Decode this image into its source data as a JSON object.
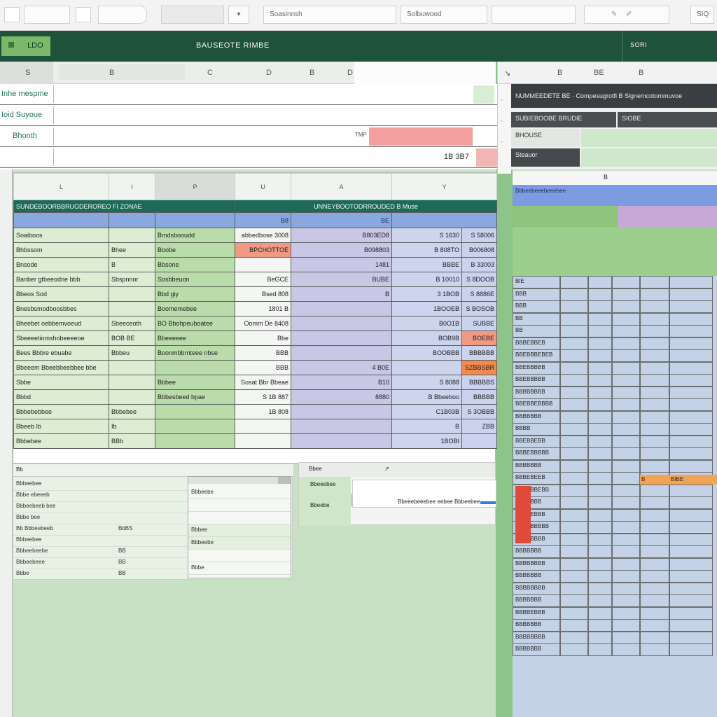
{
  "toolbar": {
    "field_1": "",
    "field_2": "",
    "field_3": "",
    "field_4": "Soasinnsh",
    "field_5": "Solbuwood",
    "field_6": "",
    "help_label": "SIQ"
  },
  "ribbon": {
    "active_tab": "LDO",
    "title": "BAUSEOTE RIMBE",
    "right_label": "SORI"
  },
  "column_headers": {
    "corner": "S",
    "cols": [
      "B",
      "C",
      "D",
      "B",
      "D"
    ],
    "right_cols": [
      "B",
      "BE",
      "B"
    ]
  },
  "formula_rows": [
    {
      "label": "Inhe mespme",
      "value": ""
    },
    {
      "label": "Ioid Suyoue",
      "value": ""
    },
    {
      "label": "Bhonth",
      "value": "TMP"
    },
    {
      "label": "",
      "value": "1B 3B7"
    }
  ],
  "right_panel": {
    "header_text": "NUMMEEDETE BE · Compesugrotfi B Slgnemcotommuvoe",
    "sub_left": "SUBIEBOOBE BRUDIE",
    "sub_right": "SIOBE",
    "label_1": "BHOUSE",
    "label_2": "Steauor"
  },
  "main_sheet": {
    "col_headers": [
      "L",
      "I",
      "P",
      "U",
      "A",
      "Y"
    ],
    "title_left": "SUNDEBOORBBRUODEROREO FI ZONAE",
    "title_right": "UNNEYBOOTODRROUDED B Muse",
    "sub_row": [
      "",
      "",
      "",
      "",
      "B8",
      "BE",
      ""
    ],
    "rows": [
      [
        "Soaiboos",
        "",
        "Bmdsbooudd",
        "abbedbose 3008",
        "B803ED8",
        "S 1630",
        "S 58006"
      ],
      [
        "Bhbssom",
        "Bhee",
        "Boobe",
        "BPCHOTTOE",
        "B098803",
        "B 808TO",
        "B006808"
      ],
      [
        "Bnsode",
        "B",
        "Bbsone",
        "",
        "1481",
        "BBBE",
        "B 33003"
      ],
      [
        "Banber gtbeeodne bbb",
        "Sbspnnor",
        "Sosbbeuon",
        "BeGCE",
        "BUBE",
        "B 10010",
        "S 8DOOB"
      ],
      [
        "Bbeos Sod",
        "",
        "Bbd giy",
        "Bsed 808",
        "B",
        "3 1BOB",
        "S 8886E"
      ],
      [
        "Bnesbsmodboosbbes",
        "",
        "Boomemebee",
        "1801 B",
        "",
        "1BOOEB",
        "S BOSOB"
      ],
      [
        "Bheebet oebbemvoeud",
        "Sbeeceoth",
        "BO Bbohpeuboatee",
        "Oomm De 8408",
        "",
        "B0O1B",
        "SUBBE"
      ],
      [
        "Sbeeeetiomshobeeeeoe",
        "BOB BE",
        "Bbeeeeee",
        "Bbe",
        "",
        "BOB9B",
        "BOEBE"
      ],
      [
        "Bees Bbbre ebuabe",
        "Bbbeu",
        "Boonmbbrnteee nbse",
        "BBB",
        "",
        "BOOBBB",
        "BBBBBB"
      ],
      [
        "Bbeeem Bbeebbeebbee bbe",
        "",
        "",
        "BBB",
        "4 B0E",
        "",
        "SZBBSBR"
      ],
      [
        "Sbbe",
        "",
        "Bbbee",
        "Sosat Bbr Bbeae",
        "B10",
        "S 8088",
        "BBBBBS"
      ],
      [
        "Bbbd",
        "",
        "Bbbesbeed bpae",
        "S 1B 887",
        "8880",
        "B Bbeeboo",
        "BBBBB"
      ],
      [
        "Bbbebebbee",
        "Bbbebee",
        "",
        "1B 808",
        "",
        "C1B03B",
        "S 3OBBB"
      ],
      [
        "Bbeeb Ib",
        "Ib",
        "",
        "",
        "",
        "B",
        "ZBB"
      ],
      [
        "Bbbebee",
        "BBb",
        "",
        "",
        "",
        "1BOBI",
        ""
      ]
    ]
  },
  "sub_panel_a": {
    "header": "Bb",
    "rows": [
      "Bbbeebee",
      "Bbbe ebeeeb",
      "Bbbeebeeb bee",
      "Bbbe bee",
      "Bb Bbbeebeeb",
      "Bbbeebee",
      "Bbbeebeebe",
      "Bbbeebeee",
      "Bbbe"
    ],
    "values": [
      "",
      "",
      "",
      "",
      "BbBS",
      "",
      "BB",
      "BB",
      "BB"
    ]
  },
  "sub_panel_b": {
    "rows": [
      "Bbbeebe",
      "",
      "",
      "Bbbee",
      "Bbbeebe",
      "",
      "Bbbe"
    ]
  },
  "sub_panel_c": {
    "label_a": "Bbee",
    "label_b": "Bbeeebee",
    "label_c": "Bbeebe",
    "tooltip": "Bbeeebeeebee eebee  Bbbeebee"
  },
  "right_grid": {
    "header_row": "Bbbeebeeebeeebee",
    "cells_col0": [
      "BIE",
      "BBB",
      "BBB",
      "BB",
      "BB",
      "BBBEBBEB",
      "BBEBBBEBEB",
      "BBEBBBBB",
      "BBEBBBBB",
      "BBBBBBBB",
      "BBEBBEBBBB",
      "BBBBBBB",
      "BBBB",
      "BBEBBEBB",
      "BBBEBBBBB",
      "BBBBBBB",
      "BBBEBEEB",
      "BBBEBBEBB",
      "BBBEBBB",
      "BBBBEBBB",
      "BBEBBBBBB",
      "BBBBBBBB",
      "BBBBBBB",
      "BBBBBBBB",
      "BBBBBBB",
      "BBBBBBBB",
      "BBBBBBB",
      "BBBBEBBB",
      "BBBBBBB",
      "BBBBBBBB",
      "BBBBBBB"
    ],
    "orange_cell": "BIBE",
    "orange_cell_2": "B"
  },
  "colors": {
    "ribbon": "#1f5339",
    "accent_green": "#7ab86a",
    "title_teal": "#1c6b58",
    "header_blue": "#8aa8de",
    "lavender": "#c9c6e6",
    "alert_red": "#f09a86",
    "alert_orange": "#f08a50"
  }
}
